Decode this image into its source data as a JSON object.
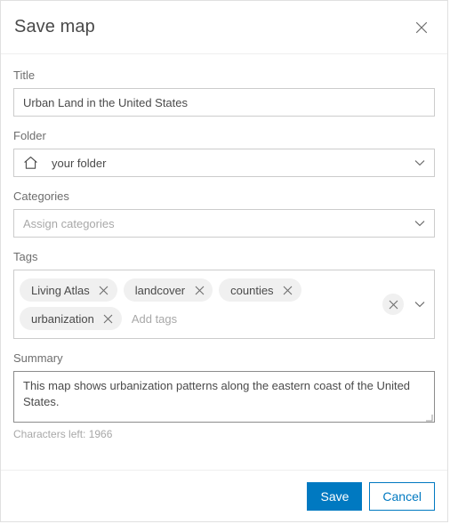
{
  "dialog": {
    "title": "Save map",
    "close_icon": "close-icon"
  },
  "fields": {
    "title": {
      "label": "Title",
      "value": "Urban Land in the United States",
      "placeholder": "Title"
    },
    "folder": {
      "label": "Folder",
      "value": "your folder",
      "icon": "home-icon",
      "chevron": "chevron-down-icon"
    },
    "categories": {
      "label": "Categories",
      "value": "",
      "placeholder": "Assign categories",
      "chevron": "chevron-down-icon"
    },
    "tags": {
      "label": "Tags",
      "items": [
        "Living Atlas",
        "landcover",
        "counties",
        "urbanization"
      ],
      "placeholder": "Add tags",
      "clear_icon": "close-icon",
      "chevron": "chevron-down-icon"
    },
    "summary": {
      "label": "Summary",
      "value": "This map shows urbanization patterns along the eastern coast of the United States.",
      "placeholder": "Summary",
      "characters_left": "Characters left: 1966"
    }
  },
  "footer": {
    "save_label": "Save",
    "cancel_label": "Cancel"
  },
  "colors": {
    "accent": "#0079c1",
    "label_text": "#6e6e6e",
    "value_text": "#4a4a4a",
    "placeholder_text": "#a8a8a8",
    "border": "#cccccc",
    "pill_bg": "#f0f0f0"
  }
}
